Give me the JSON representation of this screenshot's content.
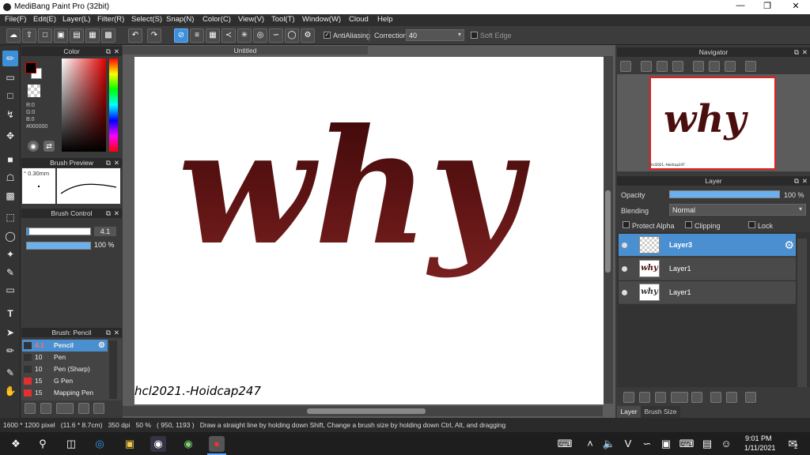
{
  "app": {
    "title": "MediBang Paint Pro (32bit)"
  },
  "menu": [
    "File(F)",
    "Edit(E)",
    "Layer(L)",
    "Filter(R)",
    "Select(S)",
    "Snap(N)",
    "Color(C)",
    "View(V)",
    "Tool(T)",
    "Window(W)",
    "Cloud",
    "Help"
  ],
  "toolbar": {
    "antialiasing_label": "AntiAliasing",
    "correction_label": "Correction",
    "correction_value": "40",
    "soft_edge_label": "Soft Edge"
  },
  "color_panel": {
    "title": "Color",
    "r": "R:0",
    "g": "G:0",
    "b": "B:0",
    "hex": "#000000",
    "fg": "#000000",
    "bg": "#ffffff"
  },
  "brush_preview": {
    "title": "Brush Preview",
    "size": "° 0.30mm"
  },
  "brush_control": {
    "title": "Brush Control",
    "size_value": "4.1",
    "opacity_value": "100 %"
  },
  "brush_list": {
    "title": "Brush: Pencil",
    "items": [
      {
        "size": "4.1",
        "name": "Pencil",
        "color": "#333333"
      },
      {
        "size": "10",
        "name": "Pen",
        "color": "#333333"
      },
      {
        "size": "10",
        "name": "Pen (Sharp)",
        "color": "#333333"
      },
      {
        "size": "15",
        "name": "G Pen",
        "color": "#e03030"
      },
      {
        "size": "15",
        "name": "Mapping Pen",
        "color": "#e03030"
      }
    ]
  },
  "canvas": {
    "tab_title": "Untitled",
    "artwork_text": "why",
    "signature": "hcl2021.-Hoidcap247"
  },
  "navigator": {
    "title": "Navigator"
  },
  "layer_panel": {
    "title": "Layer",
    "opacity_label": "Opacity",
    "opacity_value": "100 %",
    "blending_label": "Blending",
    "blending_value": "Normal",
    "protect_alpha": "Protect Alpha",
    "clipping": "Clipping",
    "lock": "Lock",
    "layers": [
      {
        "name": "Layer3"
      },
      {
        "name": "Layer1"
      },
      {
        "name": "Layer1"
      }
    ],
    "bottom_tabs": [
      "Layer",
      "Brush Size"
    ]
  },
  "status": {
    "text": "1600 * 1200 pixel   (11.6 * 8.7cm)   350 dpi   50 %   ( 950, 1193 )   Draw a straight line by holding down Shift, Change a brush size by holding down Ctrl, Alt, and dragging"
  },
  "taskbar": {
    "time": "9:01 PM",
    "date": "1/11/2021",
    "notif_count": "2"
  }
}
